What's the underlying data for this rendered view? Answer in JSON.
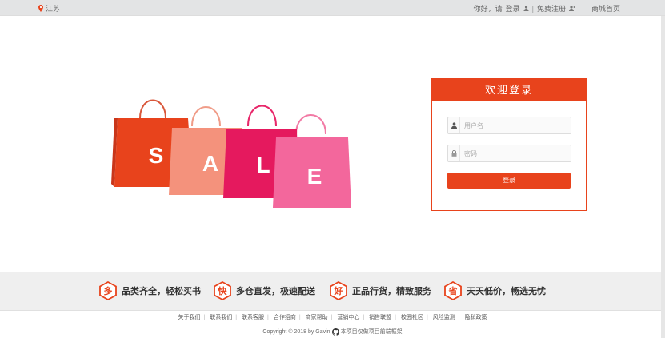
{
  "topbar": {
    "location": "江苏",
    "greeting": "你好，请",
    "login_link": "登录",
    "divider": "|",
    "register_link": "免费注册",
    "mall_home": "商城首页"
  },
  "banner": {
    "letters": [
      "S",
      "A",
      "L",
      "E"
    ]
  },
  "login": {
    "title": "欢迎登录",
    "username_placeholder": "用户名",
    "password_placeholder": "密码",
    "submit_label": "登录"
  },
  "services": [
    {
      "badge": "多",
      "text": "品类齐全，轻松买书"
    },
    {
      "badge": "快",
      "text": "多仓直发，极速配送"
    },
    {
      "badge": "好",
      "text": "正品行货，精致服务"
    },
    {
      "badge": "省",
      "text": "天天低价，畅选无忧"
    }
  ],
  "footer": {
    "links": [
      "关于我们",
      "联系我们",
      "联系客服",
      "合作招商",
      "商家帮助",
      "营销中心",
      "销售联盟",
      "校园社区",
      "风险监测",
      "隐私政策"
    ],
    "copyright": "Copyright © 2018 by Gavin",
    "project_note": "本项目仅做项目前端框架"
  },
  "colors": {
    "accent": "#e8431c",
    "topbar_bg": "#e3e4e5",
    "service_bg": "#efefef"
  }
}
